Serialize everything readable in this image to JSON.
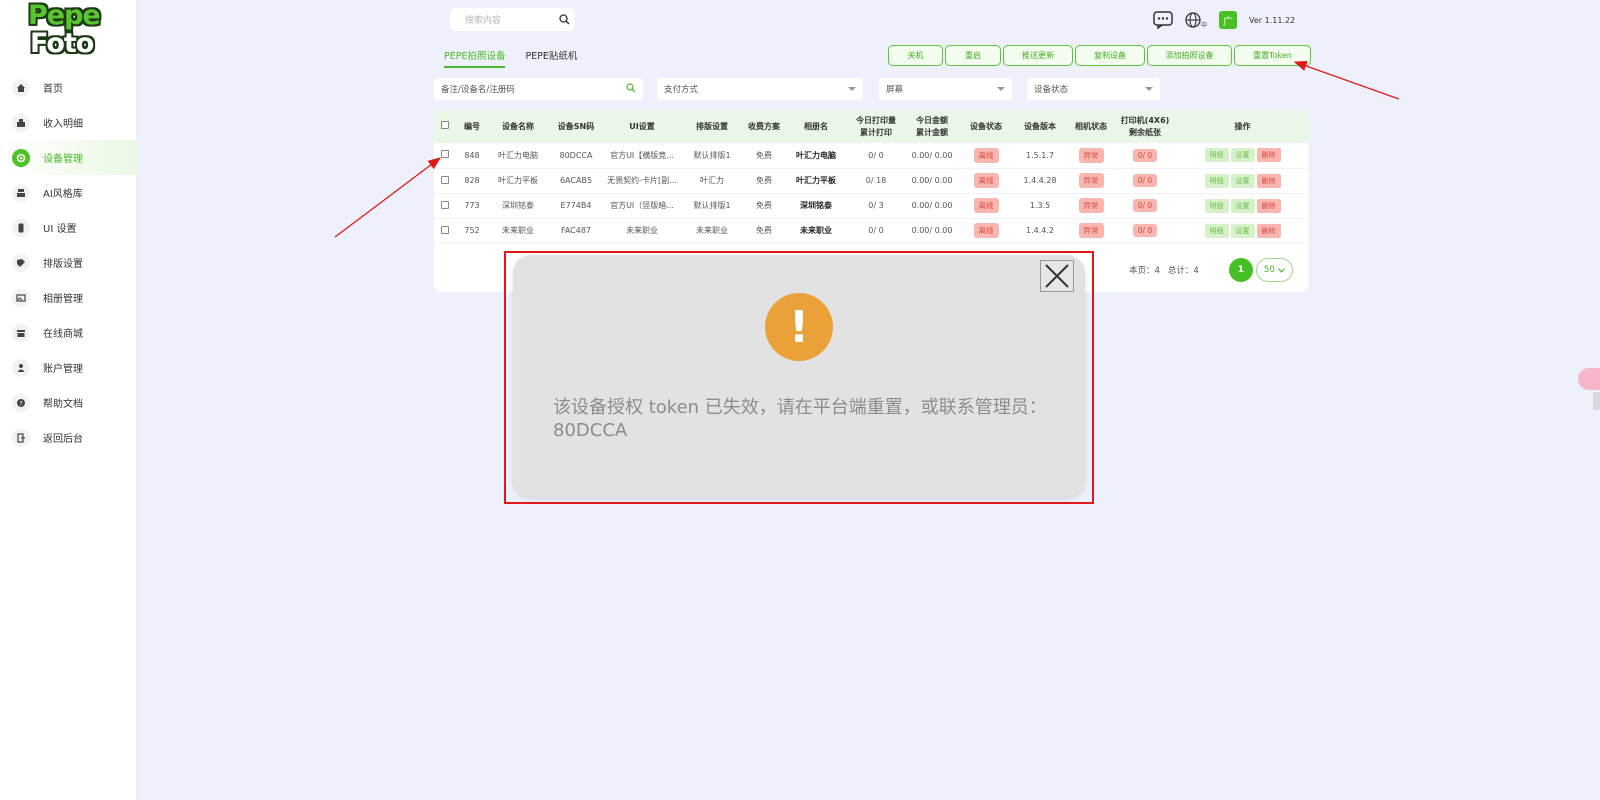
{
  "logo": {
    "word1": "Pepe",
    "word2": "Foto"
  },
  "sidebar": {
    "items": [
      {
        "label": "首页",
        "icon": "home-icon",
        "active": false
      },
      {
        "label": "收入明细",
        "icon": "chart-icon",
        "active": false
      },
      {
        "label": "设备管理",
        "icon": "gear-icon",
        "active": true
      },
      {
        "label": "AI风格库",
        "icon": "style-icon",
        "active": false
      },
      {
        "label": "UI 设置",
        "icon": "phone-icon",
        "active": false
      },
      {
        "label": "排版设置",
        "icon": "layout-icon",
        "active": false
      },
      {
        "label": "相册管理",
        "icon": "album-icon",
        "active": false
      },
      {
        "label": "在线商城",
        "icon": "store-icon",
        "active": false
      },
      {
        "label": "账户管理",
        "icon": "user-icon",
        "active": false
      },
      {
        "label": "帮助文档",
        "icon": "help-icon",
        "active": false
      },
      {
        "label": "返回后台",
        "icon": "exit-icon",
        "active": false
      }
    ]
  },
  "header": {
    "search_placeholder": "搜索内容",
    "lang_sub": "中",
    "badge": "广",
    "version": "Ver 1.11.22"
  },
  "tabs": [
    {
      "label": "PEPE拍照设备",
      "active": true
    },
    {
      "label": "PEPE贴纸机",
      "active": false
    }
  ],
  "actions": [
    "关机",
    "重启",
    "推送更新",
    "复制设备",
    "添加拍照设备",
    "重置Token"
  ],
  "filters": {
    "search_placeholder": "备注/设备名/注册码",
    "payment": "支付方式",
    "screen": "屏幕",
    "status": "设备状态"
  },
  "table": {
    "headers": [
      "编号",
      "设备名称",
      "设备SN码",
      "UI设置",
      "排版设置",
      "收费方案",
      "相册名",
      "今日打印量\n累计打印",
      "今日金额\n累计金额",
      "设备状态",
      "设备版本",
      "相机状态",
      "打印机(4X6)\n剩余纸张",
      "操作"
    ],
    "rows": [
      {
        "id": "848",
        "name": "叶汇力电脑",
        "sn": "80DCCA",
        "ui": "官方UI【横版竞...",
        "layout": "默认排版1",
        "fee": "免费",
        "album": "叶汇力电脑",
        "prints": "0/ 0",
        "amount": "0.00/ 0.00",
        "status": "离线",
        "version": "1.5.1.7",
        "camera": "异常",
        "paper": "0/ 0"
      },
      {
        "id": "828",
        "name": "叶汇力平板",
        "sn": "6ACAB5",
        "ui": "无畏契约-卡片[副...",
        "layout": "叶汇力",
        "fee": "免费",
        "album": "叶汇力平板",
        "prints": "0/ 18",
        "amount": "0.00/ 0.00",
        "status": "离线",
        "version": "1.4.4.28",
        "camera": "异常",
        "paper": "0/ 0"
      },
      {
        "id": "773",
        "name": "深圳铭泰",
        "sn": "E774B4",
        "ui": "官方UI（竖版暗...",
        "layout": "默认排版1",
        "fee": "免费",
        "album": "深圳铭泰",
        "prints": "0/ 3",
        "amount": "0.00/ 0.00",
        "status": "离线",
        "version": "1.3.5",
        "camera": "异常",
        "paper": "0/ 0"
      },
      {
        "id": "752",
        "name": "未来职业",
        "sn": "FAC487",
        "ui": "未来职业",
        "layout": "未来职业",
        "fee": "免费",
        "album": "未来职业",
        "prints": "0/ 0",
        "amount": "0.00/ 0.00",
        "status": "离线",
        "version": "1.4.4.2",
        "camera": "异常",
        "paper": "0/ 0"
      }
    ],
    "ops": [
      "明细",
      "设置",
      "删除"
    ]
  },
  "pager": {
    "page_label": "本页：4",
    "total_label": "总计：4",
    "current": "1",
    "size": "50"
  },
  "modal": {
    "message": "该设备授权 token 已失效，请在平台端重置，或联系管理员：80DCCA",
    "icon": "warning-icon"
  },
  "colors": {
    "accent": "#4cb92a",
    "background": "#eef1fb",
    "danger": "#e04a3d",
    "warning": "#eaa13a",
    "annotation": "#e01818"
  }
}
